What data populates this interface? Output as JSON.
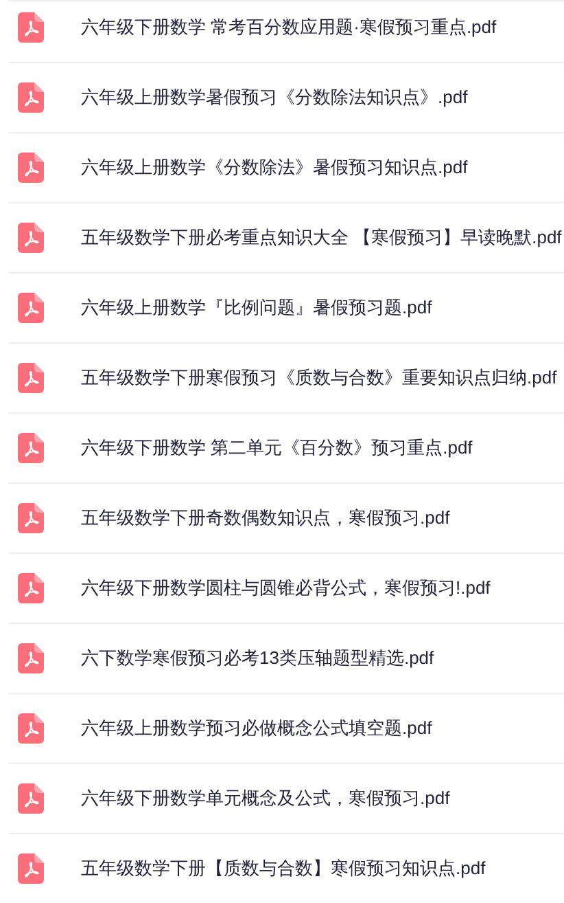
{
  "files": [
    {
      "name": "六年级下册数学 常考百分数应用题·寒假预习重点.pdf"
    },
    {
      "name": "六年级上册数学暑假预习《分数除法知识点》.pdf"
    },
    {
      "name": "六年级上册数学《分数除法》暑假预习知识点.pdf"
    },
    {
      "name": "五年级数学下册必考重点知识大全 【寒假预习】早读晚默.pdf"
    },
    {
      "name": "六年级上册数学『比例问题』暑假预习题.pdf"
    },
    {
      "name": "五年级数学下册寒假预习《质数与合数》重要知识点归纳.pdf"
    },
    {
      "name": "六年级下册数学 第二单元《百分数》预习重点.pdf"
    },
    {
      "name": "五年级数学下册奇数偶数知识点，寒假预习.pdf"
    },
    {
      "name": "六年级下册数学圆柱与圆锥必背公式，寒假预习!.pdf"
    },
    {
      "name": "六下数学寒假预习必考13类压轴题型精选.pdf"
    },
    {
      "name": "六年级上册数学预习必做概念公式填空题.pdf"
    },
    {
      "name": "六年级下册数学单元概念及公式，寒假预习.pdf"
    },
    {
      "name": "五年级数学下册【质数与合数】寒假预习知识点.pdf"
    }
  ]
}
